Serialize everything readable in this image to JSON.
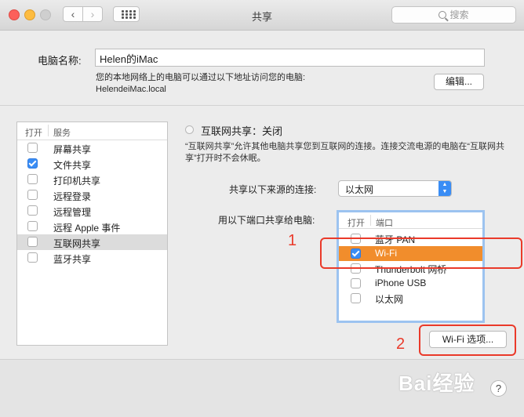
{
  "window": {
    "title": "共享"
  },
  "toolbar": {
    "back_glyph": "‹",
    "forward_glyph": "›",
    "search_placeholder": "搜索"
  },
  "computer": {
    "name_label": "电脑名称:",
    "name_value": "Helen的iMac",
    "address_line1": "您的本地网络上的电脑可以通过以下地址访问您的电脑:",
    "address_line2": "HelendeiMac.local",
    "edit_label": "编辑..."
  },
  "services": {
    "header_on": "打开",
    "header_service": "服务",
    "items": [
      {
        "label": "屏幕共享",
        "checked": false,
        "selected": false
      },
      {
        "label": "文件共享",
        "checked": true,
        "selected": false
      },
      {
        "label": "打印机共享",
        "checked": false,
        "selected": false
      },
      {
        "label": "远程登录",
        "checked": false,
        "selected": false
      },
      {
        "label": "远程管理",
        "checked": false,
        "selected": false
      },
      {
        "label": "远程 Apple 事件",
        "checked": false,
        "selected": false
      },
      {
        "label": "互联网共享",
        "checked": false,
        "selected": true
      },
      {
        "label": "蓝牙共享",
        "checked": false,
        "selected": false
      }
    ]
  },
  "detail": {
    "status": "互联网共享：关闭",
    "description": "“互联网共享”允许其他电脑共享您到互联网的连接。连接交流电源的电脑在“互联网共享”打开时不会休眠。",
    "source_label": "共享以下来源的连接:",
    "source_value": "以太网",
    "ports_label": "用以下端口共享给电脑:",
    "ports_header_on": "打开",
    "ports_header_port": "端口",
    "ports": [
      {
        "label": "蓝牙 PAN",
        "checked": false,
        "selected": false
      },
      {
        "label": "Wi-Fi",
        "checked": true,
        "selected": true
      },
      {
        "label": "Thunderbolt 网桥",
        "checked": false,
        "selected": false
      },
      {
        "label": "iPhone USB",
        "checked": false,
        "selected": false
      },
      {
        "label": "以太网",
        "checked": false,
        "selected": false
      }
    ],
    "wifi_options_label": "Wi-Fi 选项..."
  },
  "annotations": {
    "one": "1",
    "two": "2"
  },
  "help_label": "?",
  "watermark": "Bai经验",
  "colors": {
    "accent": "#3a8df5",
    "selection": "#f18d2c",
    "annotation": "#ea3a2a"
  }
}
